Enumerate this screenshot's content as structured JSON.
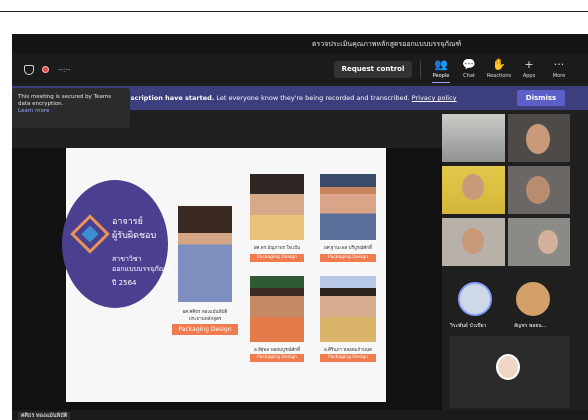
{
  "window": {
    "title": "ตรวจประเมินคุณภาพหลักสูตรออกแบบบรรจุภัณฑ์"
  },
  "toolbar": {
    "timer": "--:--",
    "request_control": "Request control",
    "tools": [
      {
        "label": "People",
        "icon": "people-icon",
        "glyph": "👥"
      },
      {
        "label": "Chat",
        "icon": "chat-icon",
        "glyph": "💬"
      },
      {
        "label": "Reactions",
        "icon": "reactions-icon",
        "glyph": "✋"
      },
      {
        "label": "Apps",
        "icon": "apps-icon",
        "glyph": "+"
      },
      {
        "label": "More",
        "icon": "more-icon",
        "glyph": "···"
      }
    ]
  },
  "banner": {
    "text_start": "nscription have started.",
    "text_rest": " Let everyone know they're being recorded and transcribed.",
    "privacy": "Privacy policy",
    "dismiss": "Dismiss"
  },
  "tooltip": {
    "line1": "This meeting is secured by Teams",
    "line2": "data encryption.",
    "learn_more": "Learn more"
  },
  "slide": {
    "heading1": "อาจารย์",
    "heading2": "ผู้รับผิดชอบ",
    "program1": "สาขาวิชา",
    "program2": "ออกแบบบรรจุภัณฑ์",
    "year": "ปี 2564",
    "lead_name": "ผศ.ศศิธร ทองแม้นพิบัติ",
    "lead_role": "ประธานหลักสูตร",
    "tag": "Packaging Design",
    "members": [
      {
        "name": "ผศ.ดร.ธัญภาพร ใจแป้น",
        "tag": "Packaging Design"
      },
      {
        "name": "ผศ.ฐานะพล บริบูรณ์ศักดิ์",
        "tag": "Packaging Design"
      },
      {
        "name": "อ.สิฐุพล พลสมบูรณ์ศักดิ์",
        "tag": "Packaging Design"
      },
      {
        "name": "อ.ศิรินภา หลอดแก้วนนท",
        "tag": "Packaging Design"
      }
    ]
  },
  "participants": {
    "named": [
      {
        "name": "วิระพันธ์ บัวเขียว"
      },
      {
        "name": "สัญชร พลยน..."
      }
    ]
  },
  "presenter": {
    "name": "ศศิธร ทองแม้นพิบัติ"
  }
}
